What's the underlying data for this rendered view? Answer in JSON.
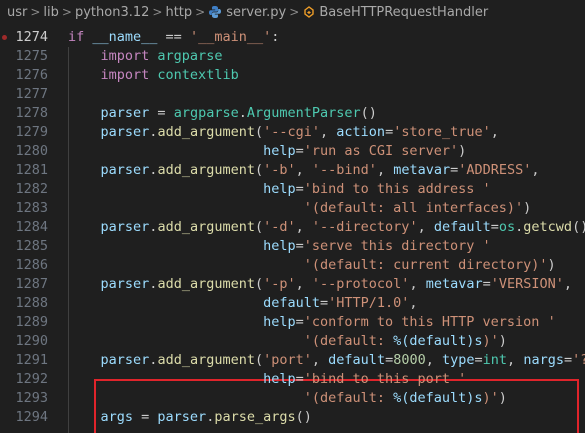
{
  "breadcrumb": {
    "items": [
      "usr",
      "lib",
      "python3.12",
      "http",
      "server.py",
      "BaseHTTPRequestHandler"
    ],
    "separator": ">"
  },
  "editor": {
    "active_line": "1274",
    "lines": [
      {
        "num": "1274",
        "tokens": [
          [
            "kw",
            "if "
          ],
          [
            "var",
            "__name__"
          ],
          [
            "plain",
            " == "
          ],
          [
            "str",
            "'__main__'"
          ],
          [
            "plain",
            ":"
          ]
        ]
      },
      {
        "num": "1275",
        "tokens": [
          [
            "plain",
            "    "
          ],
          [
            "kw",
            "import "
          ],
          [
            "cls",
            "argparse"
          ]
        ]
      },
      {
        "num": "1276",
        "tokens": [
          [
            "plain",
            "    "
          ],
          [
            "kw",
            "import "
          ],
          [
            "cls",
            "contextlib"
          ]
        ]
      },
      {
        "num": "1277",
        "tokens": []
      },
      {
        "num": "1278",
        "tokens": [
          [
            "plain",
            "    "
          ],
          [
            "var",
            "parser"
          ],
          [
            "plain",
            " = "
          ],
          [
            "cls",
            "argparse"
          ],
          [
            "plain",
            "."
          ],
          [
            "cls",
            "ArgumentParser"
          ],
          [
            "plain",
            "()"
          ]
        ]
      },
      {
        "num": "1279",
        "tokens": [
          [
            "plain",
            "    "
          ],
          [
            "var",
            "parser"
          ],
          [
            "plain",
            "."
          ],
          [
            "fn",
            "add_argument"
          ],
          [
            "plain",
            "("
          ],
          [
            "str",
            "'--cgi'"
          ],
          [
            "plain",
            ", "
          ],
          [
            "var",
            "action"
          ],
          [
            "plain",
            "="
          ],
          [
            "str",
            "'store_true'"
          ],
          [
            "plain",
            ","
          ]
        ]
      },
      {
        "num": "1280",
        "tokens": [
          [
            "plain",
            "                        "
          ],
          [
            "var",
            "help"
          ],
          [
            "plain",
            "="
          ],
          [
            "str",
            "'run as CGI server'"
          ],
          [
            "plain",
            ")"
          ]
        ]
      },
      {
        "num": "1281",
        "tokens": [
          [
            "plain",
            "    "
          ],
          [
            "var",
            "parser"
          ],
          [
            "plain",
            "."
          ],
          [
            "fn",
            "add_argument"
          ],
          [
            "plain",
            "("
          ],
          [
            "str",
            "'-b'"
          ],
          [
            "plain",
            ", "
          ],
          [
            "str",
            "'--bind'"
          ],
          [
            "plain",
            ", "
          ],
          [
            "var",
            "metavar"
          ],
          [
            "plain",
            "="
          ],
          [
            "str",
            "'ADDRESS'"
          ],
          [
            "plain",
            ","
          ]
        ]
      },
      {
        "num": "1282",
        "tokens": [
          [
            "plain",
            "                        "
          ],
          [
            "var",
            "help"
          ],
          [
            "plain",
            "="
          ],
          [
            "str",
            "'bind to this address '"
          ]
        ]
      },
      {
        "num": "1283",
        "tokens": [
          [
            "plain",
            "                             "
          ],
          [
            "str",
            "'(default: all interfaces)'"
          ],
          [
            "plain",
            ")"
          ]
        ]
      },
      {
        "num": "1284",
        "tokens": [
          [
            "plain",
            "    "
          ],
          [
            "var",
            "parser"
          ],
          [
            "plain",
            "."
          ],
          [
            "fn",
            "add_argument"
          ],
          [
            "plain",
            "("
          ],
          [
            "str",
            "'-d'"
          ],
          [
            "plain",
            ", "
          ],
          [
            "str",
            "'--directory'"
          ],
          [
            "plain",
            ", "
          ],
          [
            "var",
            "default"
          ],
          [
            "plain",
            "="
          ],
          [
            "cls",
            "os"
          ],
          [
            "plain",
            "."
          ],
          [
            "fn",
            "getcwd"
          ],
          [
            "plain",
            "(),"
          ]
        ]
      },
      {
        "num": "1285",
        "tokens": [
          [
            "plain",
            "                        "
          ],
          [
            "var",
            "help"
          ],
          [
            "plain",
            "="
          ],
          [
            "str",
            "'serve this directory '"
          ]
        ]
      },
      {
        "num": "1286",
        "tokens": [
          [
            "plain",
            "                             "
          ],
          [
            "str",
            "'(default: current directory)'"
          ],
          [
            "plain",
            ")"
          ]
        ]
      },
      {
        "num": "1287",
        "tokens": [
          [
            "plain",
            "    "
          ],
          [
            "var",
            "parser"
          ],
          [
            "plain",
            "."
          ],
          [
            "fn",
            "add_argument"
          ],
          [
            "plain",
            "("
          ],
          [
            "str",
            "'-p'"
          ],
          [
            "plain",
            ", "
          ],
          [
            "str",
            "'--protocol'"
          ],
          [
            "plain",
            ", "
          ],
          [
            "var",
            "metavar"
          ],
          [
            "plain",
            "="
          ],
          [
            "str",
            "'VERSION'"
          ],
          [
            "plain",
            ","
          ]
        ]
      },
      {
        "num": "1288",
        "tokens": [
          [
            "plain",
            "                        "
          ],
          [
            "var",
            "default"
          ],
          [
            "plain",
            "="
          ],
          [
            "str",
            "'HTTP/1.0'"
          ],
          [
            "plain",
            ","
          ]
        ]
      },
      {
        "num": "1289",
        "tokens": [
          [
            "plain",
            "                        "
          ],
          [
            "var",
            "help"
          ],
          [
            "plain",
            "="
          ],
          [
            "str",
            "'conform to this HTTP version '"
          ]
        ]
      },
      {
        "num": "1290",
        "tokens": [
          [
            "plain",
            "                             "
          ],
          [
            "str",
            "'(default: "
          ],
          [
            "var",
            "%(default)s"
          ],
          [
            "str",
            ")'"
          ],
          [
            "plain",
            ")"
          ]
        ]
      },
      {
        "num": "1291",
        "tokens": [
          [
            "plain",
            "    "
          ],
          [
            "var",
            "parser"
          ],
          [
            "plain",
            "."
          ],
          [
            "fn",
            "add_argument"
          ],
          [
            "plain",
            "("
          ],
          [
            "str",
            "'port'"
          ],
          [
            "plain",
            ", "
          ],
          [
            "var",
            "default"
          ],
          [
            "plain",
            "="
          ],
          [
            "num",
            "8000"
          ],
          [
            "plain",
            ", "
          ],
          [
            "var",
            "type"
          ],
          [
            "plain",
            "="
          ],
          [
            "cls",
            "int"
          ],
          [
            "plain",
            ", "
          ],
          [
            "var",
            "nargs"
          ],
          [
            "plain",
            "="
          ],
          [
            "str",
            "'?'"
          ],
          [
            "plain",
            ","
          ]
        ]
      },
      {
        "num": "1292",
        "tokens": [
          [
            "plain",
            "                        "
          ],
          [
            "var",
            "help"
          ],
          [
            "plain",
            "="
          ],
          [
            "str",
            "'bind to this port '"
          ]
        ]
      },
      {
        "num": "1293",
        "tokens": [
          [
            "plain",
            "                             "
          ],
          [
            "str",
            "'(default: "
          ],
          [
            "var",
            "%(default)s"
          ],
          [
            "str",
            ")'"
          ],
          [
            "plain",
            ")"
          ]
        ]
      },
      {
        "num": "1294",
        "tokens": [
          [
            "plain",
            "    "
          ],
          [
            "var",
            "args"
          ],
          [
            "plain",
            " = "
          ],
          [
            "var",
            "parser"
          ],
          [
            "plain",
            "."
          ],
          [
            "fn",
            "parse_args"
          ],
          [
            "plain",
            "()"
          ]
        ]
      }
    ]
  },
  "colors": {
    "background": "#1f1f1f",
    "keyword": "#c586c0",
    "function": "#dcdcaa",
    "string": "#ce9178",
    "number": "#b5cea8",
    "variable": "#9cdcfe",
    "class": "#4ec9b0",
    "highlight_border": "#e0242b"
  },
  "icons": {
    "file": "python-file-icon",
    "symbol": "class-symbol-icon",
    "breakpoint": "breakpoint-dot"
  }
}
